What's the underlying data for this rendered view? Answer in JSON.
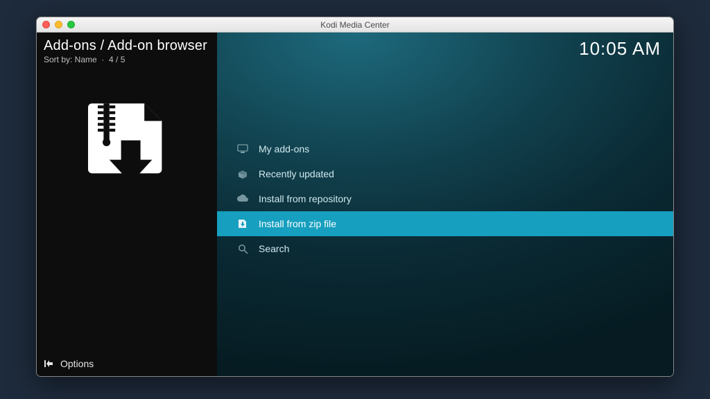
{
  "window": {
    "title": "Kodi Media Center"
  },
  "header": {
    "breadcrumb": "Add-ons / Add-on browser",
    "sort_label": "Sort by: Name",
    "position": "4 / 5",
    "clock": "10:05 AM"
  },
  "menu": {
    "items": [
      {
        "label": "My add-ons",
        "icon": "screen-icon",
        "selected": false
      },
      {
        "label": "Recently updated",
        "icon": "box-open-icon",
        "selected": false
      },
      {
        "label": "Install from repository",
        "icon": "cloud-icon",
        "selected": false
      },
      {
        "label": "Install from zip file",
        "icon": "zip-down-icon",
        "selected": true
      },
      {
        "label": "Search",
        "icon": "search-icon",
        "selected": false
      }
    ]
  },
  "footer": {
    "options_label": "Options"
  }
}
